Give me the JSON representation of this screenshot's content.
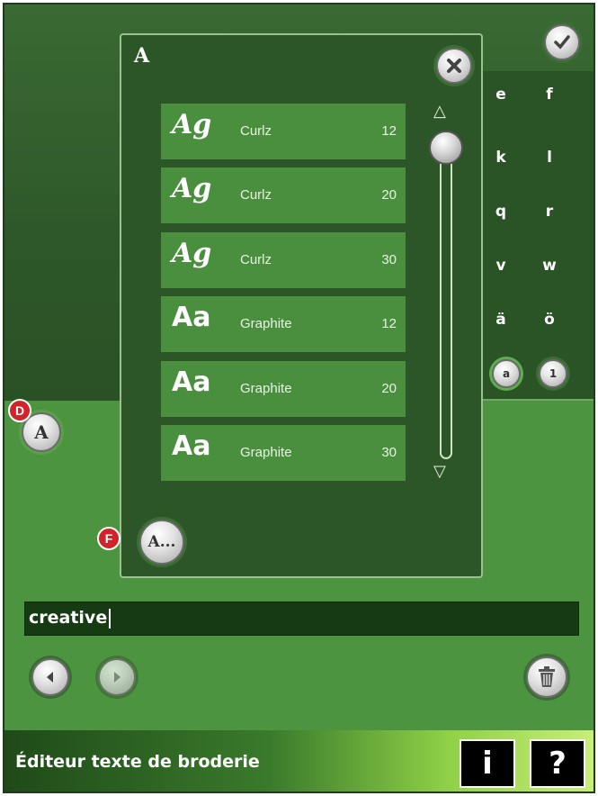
{
  "dialog": {
    "title": "A",
    "close_icon": "close-x-icon",
    "fonts": [
      {
        "sample": "Ag",
        "name": "Curlz",
        "size": "12",
        "style": "curlz"
      },
      {
        "sample": "Ag",
        "name": "Curlz",
        "size": "20",
        "style": "curlz"
      },
      {
        "sample": "Ag",
        "name": "Curlz",
        "size": "30",
        "style": "curlz"
      },
      {
        "sample": "Aa",
        "name": "Graphite",
        "size": "12",
        "style": "graphite"
      },
      {
        "sample": "Aa",
        "name": "Graphite",
        "size": "20",
        "style": "graphite"
      },
      {
        "sample": "Aa",
        "name": "Graphite",
        "size": "30",
        "style": "graphite"
      }
    ],
    "more_fonts_label": "A...",
    "scroll_up_icon": "triangle-up-icon",
    "scroll_down_icon": "triangle-down-icon"
  },
  "keyboard": {
    "rows": [
      [
        "e",
        "f"
      ],
      [
        "k",
        "l"
      ],
      [
        "q",
        "r"
      ],
      [
        "v",
        "w"
      ],
      [
        "ä",
        "ö"
      ]
    ],
    "lowercase_label": "a",
    "numbers_label": "1",
    "confirm_icon": "checkmark-icon"
  },
  "font_button_label": "A",
  "badges": {
    "d": "D",
    "f": "F"
  },
  "text_field": {
    "value": "creative"
  },
  "nav": {
    "left_icon": "arrow-left-icon",
    "right_icon": "arrow-right-icon",
    "delete_icon": "trash-icon"
  },
  "bottom_bar": {
    "title": "Éditeur texte de broderie",
    "info_label": "i",
    "help_label": "?"
  },
  "colors": {
    "dark_green": "#2d5628",
    "mid_green": "#4d9440",
    "row_green": "#4a8f3e",
    "badge_red": "#d2232a"
  }
}
